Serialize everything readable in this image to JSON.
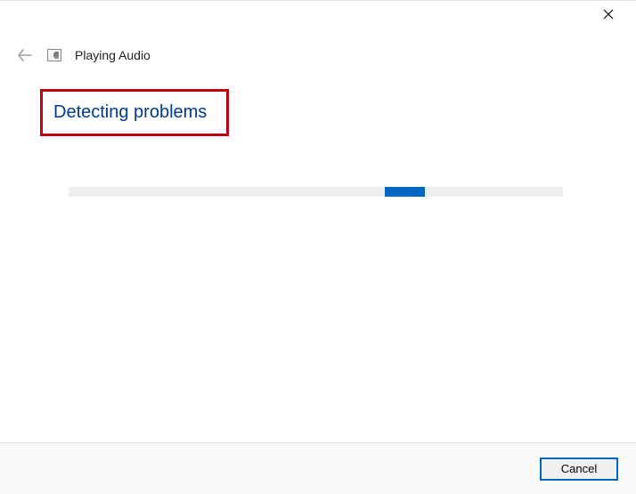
{
  "titlebar": {
    "close_label": "Close"
  },
  "header": {
    "back_label": "Back",
    "icon_name": "audio-troubleshooter-icon",
    "title": "Playing Audio"
  },
  "main": {
    "heading": "Detecting problems"
  },
  "progress": {
    "state": "indeterminate"
  },
  "footer": {
    "cancel_label": "Cancel"
  },
  "colors": {
    "accent": "#0067c0",
    "heading": "#003a8d",
    "highlight_border": "#c00010"
  }
}
